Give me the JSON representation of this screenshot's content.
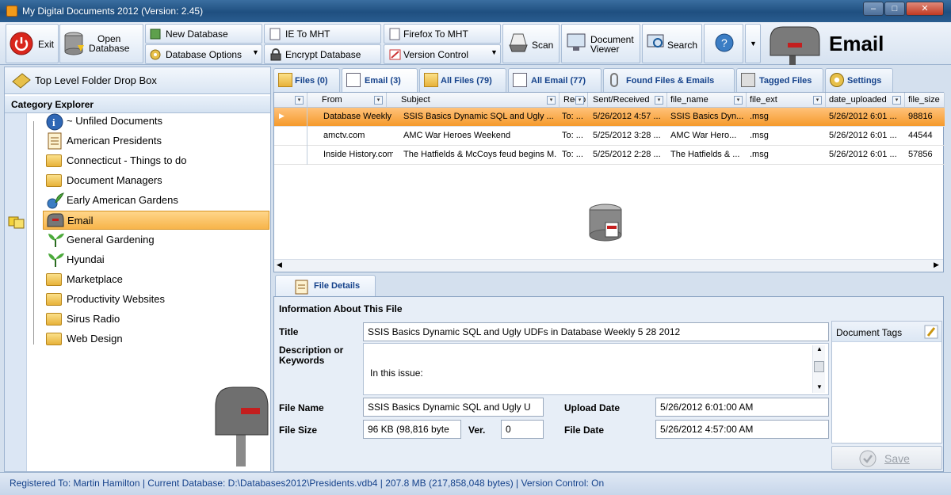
{
  "window": {
    "title": "My Digital Documents 2012 (Version: 2.45)",
    "minimize": "–",
    "maximize": "□",
    "close": "✕"
  },
  "toolbar": {
    "exit": "Exit",
    "open_database": "Open\nDatabase",
    "new_database": "New Database",
    "database_options": "Database Options",
    "ie_to_mht": "IE To MHT",
    "encrypt_database": "Encrypt Database",
    "firefox_to_mht": "Firefox To MHT",
    "version_control": "Version Control",
    "scan": "Scan",
    "document_viewer": "Document\nViewer",
    "search": "Search",
    "current_category": "Email"
  },
  "left": {
    "drop_box_label": "Top Level Folder Drop Box",
    "category_explorer_label": "Category Explorer",
    "tree": [
      {
        "label": "~ Unfiled Documents",
        "icon": "info-icon"
      },
      {
        "label": "American Presidents",
        "icon": "document-icon"
      },
      {
        "label": "Connecticut - Things to do",
        "icon": "folder-icon"
      },
      {
        "label": "Document Managers",
        "icon": "folder-icon"
      },
      {
        "label": "Early American Gardens",
        "icon": "plant-globe-icon"
      },
      {
        "label": "Email",
        "icon": "mailbox-icon"
      },
      {
        "label": "General Gardening",
        "icon": "plant-icon"
      },
      {
        "label": "Hyundai",
        "icon": "plant-icon"
      },
      {
        "label": "Marketplace",
        "icon": "folder-icon"
      },
      {
        "label": "Productivity Websites",
        "icon": "folder-icon"
      },
      {
        "label": "Sirus Radio",
        "icon": "folder-icon"
      },
      {
        "label": "Web Design",
        "icon": "folder-icon"
      }
    ]
  },
  "tabs": [
    {
      "label": "Files (0)"
    },
    {
      "label": "Email (3)"
    },
    {
      "label": "All Files (79)"
    },
    {
      "label": "All Email (77)"
    },
    {
      "label": "Found Files & Emails"
    },
    {
      "label": "Tagged Files"
    },
    {
      "label": "Settings"
    }
  ],
  "grid": {
    "columns": [
      "From",
      "Subject",
      "Recip",
      "Sent/Received",
      "file_name",
      "file_ext",
      "date_uploaded",
      "file_size"
    ],
    "rows": [
      [
        "Database Weekly",
        "SSIS Basics  Dynamic SQL and Ugly ...",
        "To: ...",
        "5/26/2012 4:57 ...",
        "SSIS Basics  Dyn...",
        ".msg",
        "5/26/2012 6:01 ...",
        "98816"
      ],
      [
        "amctv.com",
        "AMC   War Heroes Weekend",
        "To: ...",
        "5/25/2012 3:28 ...",
        "AMC   War Hero...",
        ".msg",
        "5/26/2012 6:01 ...",
        "44544"
      ],
      [
        "Inside History.com",
        "The Hatfields & McCoys feud begins M...",
        "To: ...",
        "5/25/2012 2:28 ...",
        "The Hatfields & ...",
        ".msg",
        "5/26/2012 6:01 ...",
        "57856"
      ]
    ]
  },
  "details": {
    "tab_label": "File Details",
    "header": "Information About This File",
    "title_label": "Title",
    "title_value": "SSIS Basics  Dynamic SQL and Ugly UDFs in Database Weekly  5 28 2012",
    "description_label": "Description or\nKeywords",
    "description_value": "In this issue:",
    "file_name_label": "File Name",
    "file_name_value": "SSIS Basics  Dynamic SQL and Ugly U",
    "upload_date_label": "Upload Date",
    "upload_date_value": "5/26/2012 6:01:00 AM",
    "file_size_label": "File Size",
    "file_size_value": "96 KB (98,816 byte",
    "ver_label": "Ver.",
    "ver_value": "0",
    "file_date_label": "File Date",
    "file_date_value": "5/26/2012 4:57:00 AM",
    "document_tags_label": "Document Tags",
    "save_label": "Save"
  },
  "status": {
    "text": "Registered To: Martin Hamilton |   Current Database: D:\\Databases2012\\Presidents.vdb4 |   207.8 MB (217,858,048 bytes) |   Version Control: On"
  },
  "colors": {
    "accent": "#f7a73a",
    "title_bar": "#1f4f80",
    "link_blue": "#15428b"
  }
}
